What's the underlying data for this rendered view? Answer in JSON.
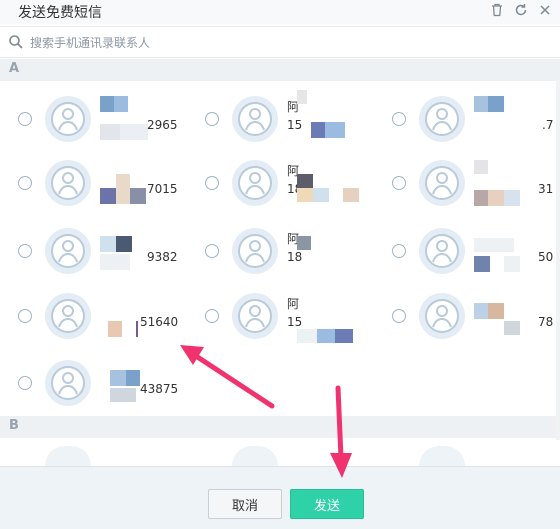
{
  "window": {
    "title": "发送免费短信",
    "icons": [
      "trash-icon",
      "refresh-icon",
      "close-icon"
    ]
  },
  "search": {
    "placeholder": "搜索手机通讯录联系人"
  },
  "sections": [
    {
      "letter": "A"
    },
    {
      "letter": "B"
    }
  ],
  "contacts": [
    {
      "name": "",
      "phone": "2965"
    },
    {
      "name": "阿",
      "phone": "15"
    },
    {
      "name": "",
      "phone": ".7"
    },
    {
      "name": "",
      "phone": "7015"
    },
    {
      "name": "阿",
      "phone": "18"
    },
    {
      "name": "",
      "phone": "31"
    },
    {
      "name": "",
      "phone": "9382"
    },
    {
      "name": "阿",
      "phone": "18"
    },
    {
      "name": "",
      "phone": "50"
    },
    {
      "name": "",
      "phone": "51640"
    },
    {
      "name": "阿",
      "phone": "15"
    },
    {
      "name": "",
      "phone": "78"
    },
    {
      "name": "",
      "phone": "43875"
    }
  ],
  "footer": {
    "cancel_label": "取消",
    "send_label": "发送"
  },
  "colors": {
    "accent": "#2fd2a8",
    "annotation_arrow": "#f0336e"
  }
}
